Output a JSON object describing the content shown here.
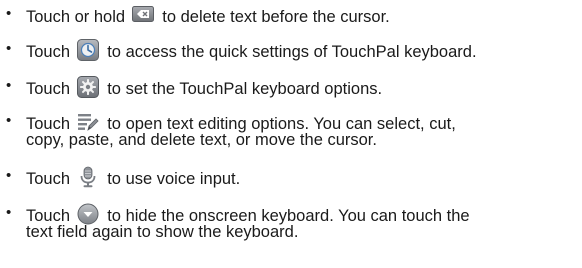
{
  "items": [
    {
      "lead": "Touch or hold",
      "icon": "backspace-key-icon",
      "line1_rest": "to delete text before the cursor.",
      "line2": ""
    },
    {
      "lead": "Touch",
      "icon": "quick-settings-icon",
      "line1_rest": "to access the quick settings of TouchPal keyboard.",
      "line2": ""
    },
    {
      "lead": "Touch",
      "icon": "gear-icon",
      "line1_rest": "to set the TouchPal keyboard options.",
      "line2": ""
    },
    {
      "lead": "Touch",
      "icon": "text-edit-icon",
      "line1_rest": "to open text editing options. You can select, cut,",
      "line2": "copy, paste, and delete text, or move the cursor."
    },
    {
      "lead": "Touch",
      "icon": "microphone-icon",
      "line1_rest": "to use voice input.",
      "line2": ""
    },
    {
      "lead": "Touch",
      "icon": "hide-keyboard-icon",
      "line1_rest": "to hide the onscreen keyboard. You can touch the",
      "line2": "text field again to show the keyboard."
    }
  ],
  "colors": {
    "text": "#1a1a1a",
    "icon_gray": "#8a8d92",
    "icon_dark": "#5f6368"
  }
}
